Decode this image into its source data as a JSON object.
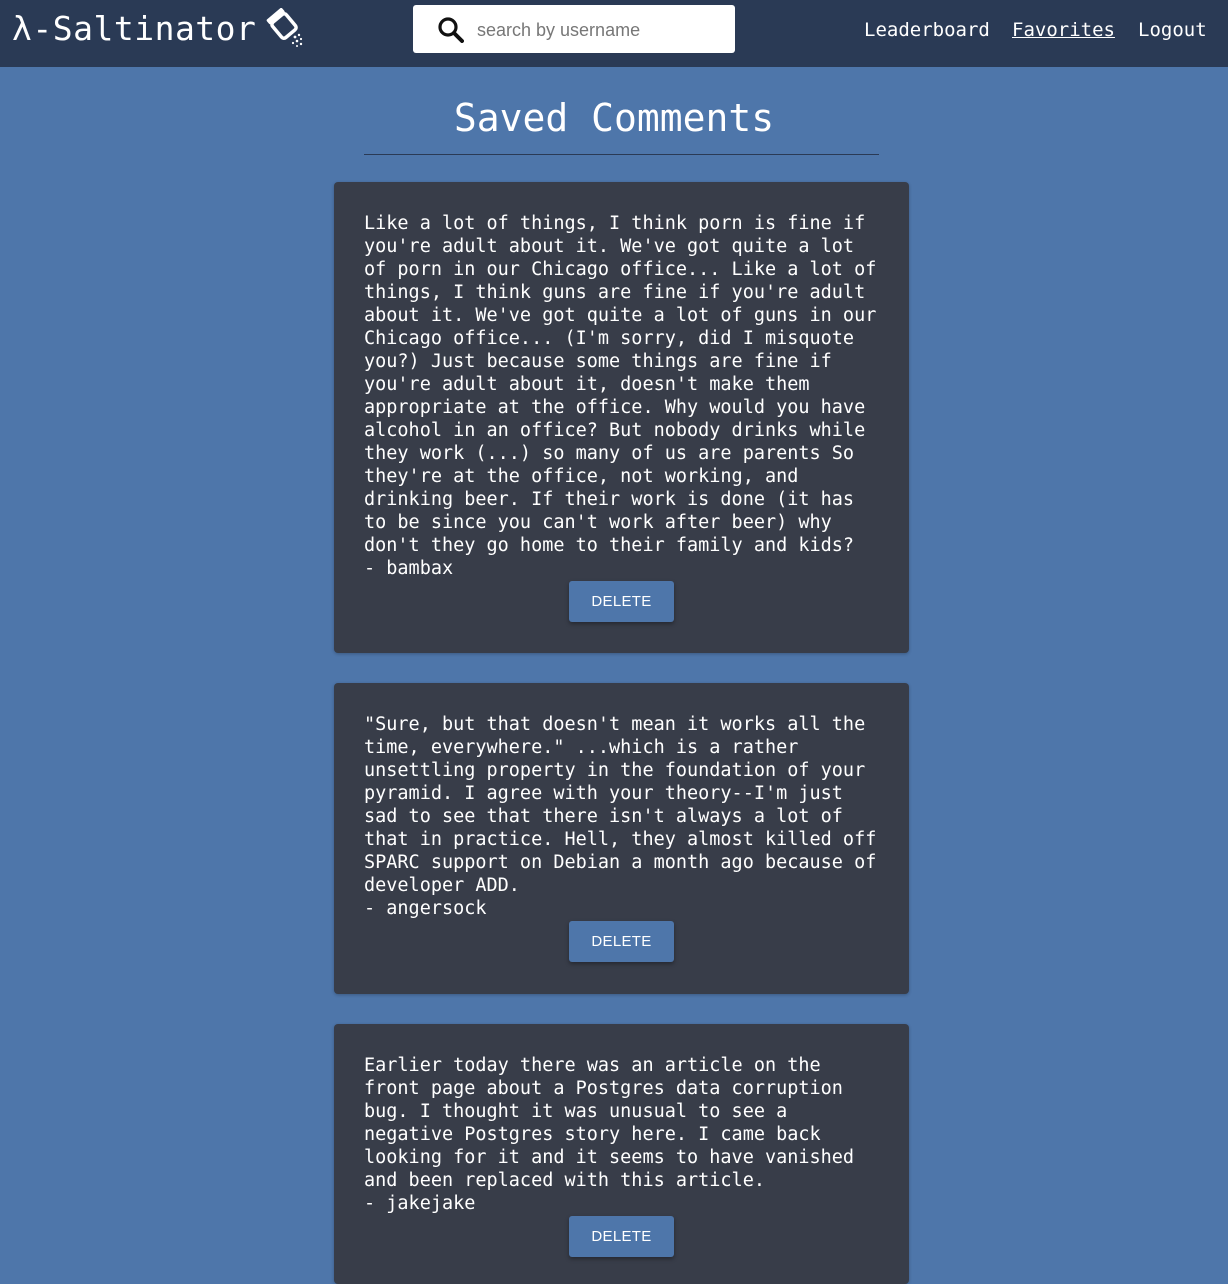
{
  "header": {
    "brand": "λ-Saltinator",
    "brand_icon": "salt-shaker-icon",
    "search": {
      "placeholder": "search by username",
      "value": "",
      "icon": "search-icon"
    },
    "nav": [
      {
        "label": "Leaderboard",
        "active": false
      },
      {
        "label": "Favorites",
        "active": true
      },
      {
        "label": "Logout",
        "active": false
      }
    ]
  },
  "main": {
    "title": "Saved Comments",
    "comments": [
      {
        "text": "Like a lot of things, I think porn is fine if you're adult about it. We've got quite a lot of porn in our Chicago office... Like a lot of things, I think guns are fine if you're adult about it. We've got quite a lot of guns in our Chicago office... (I'm sorry, did I misquote you?) Just because some things are fine if you're adult about it, doesn't make them appropriate at the office. Why would you have alcohol in an office? But nobody drinks while they work (...) so many of us are parents So they're at the office, not working, and drinking beer. If their work is done (it has to be since you can't work after beer) why don't they go home to their family and kids?",
        "author": "- bambax",
        "delete_label": "DELETE"
      },
      {
        "text": "\"Sure, but that doesn't mean it works all the time, everywhere.\" ...which is a rather unsettling property in the foundation of your pyramid. I agree with your theory--I'm just sad to see that there isn't always a lot of that in practice. Hell, they almost killed off SPARC support on Debian a month ago because of developer ADD.",
        "author": "- angersock",
        "delete_label": "DELETE"
      },
      {
        "text": "Earlier today there was an article on the front page about a Postgres data corruption bug. I thought it was unusual to see a negative Postgres story here. I came back looking for it and it seems to have vanished and been replaced with this article.",
        "author": "- jakejake",
        "delete_label": "DELETE"
      }
    ]
  },
  "colors": {
    "page_bg": "#4e76aa",
    "header_bg": "#2a3a55",
    "card_bg": "#383d49",
    "button_bg": "#4e76aa",
    "text": "#ffffff"
  }
}
